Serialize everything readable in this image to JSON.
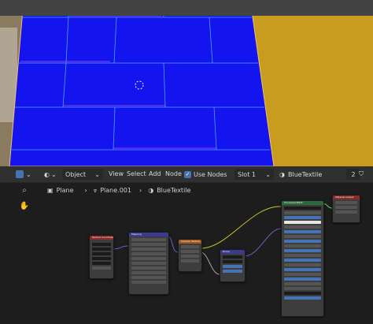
{
  "viewport": {
    "plane_color": "#1616f0",
    "ground_color": "#c79c1f"
  },
  "header": {
    "mode": "Object",
    "menus": [
      "View",
      "Select",
      "Add",
      "Node"
    ],
    "use_nodes_label": "Use Nodes",
    "use_nodes_checked": true,
    "slot": "Slot 1",
    "material_name": "BlueTextile",
    "user_count": "2"
  },
  "breadcrumb": {
    "object": "Plane",
    "mesh": "Plane.001",
    "material": "BlueTextile"
  },
  "nodes": {
    "texcoord": "Texture Coordinate",
    "mapping": "Mapping",
    "checker": "Checker Texture",
    "bump": "Bump",
    "bsdf": "Principled BSDF",
    "output": "Material Output"
  }
}
